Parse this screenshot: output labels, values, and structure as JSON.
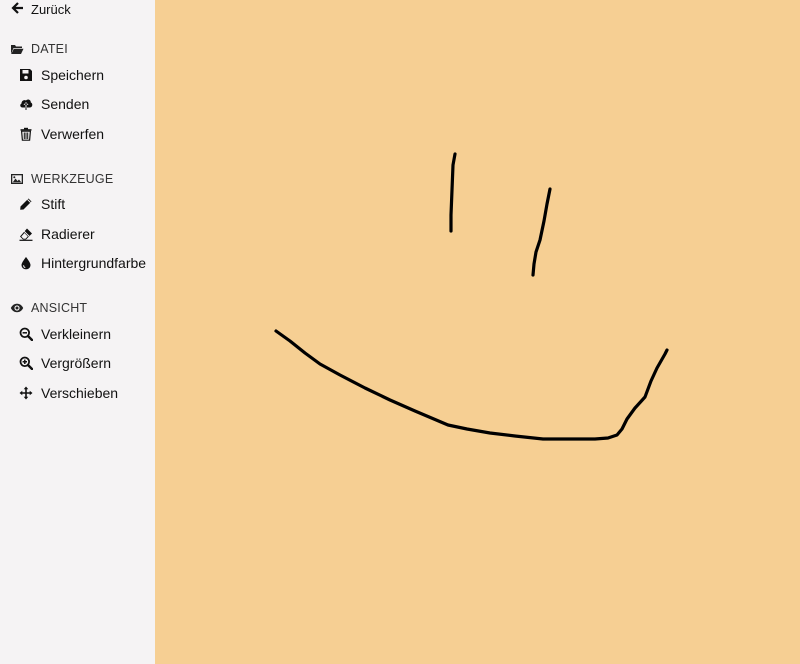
{
  "nav": {
    "back_label": "Zurück"
  },
  "sections": {
    "datei": {
      "title": "DATEI",
      "items": {
        "save": "Speichern",
        "send": "Senden",
        "discard": "Verwerfen"
      }
    },
    "werkzeuge": {
      "title": "WERKZEUGE",
      "items": {
        "pen": "Stift",
        "eraser": "Radierer",
        "background": "Hintergrundfarbe"
      }
    },
    "ansicht": {
      "title": "ANSICHT",
      "items": {
        "zoom_out": "Verkleinern",
        "zoom_in": "Vergrößern",
        "pan": "Verschieben"
      }
    }
  },
  "canvas": {
    "background_color": "#f6cf93",
    "stroke_color": "#000000"
  },
  "colors": {
    "sidebar_bg": "#f5f3f4",
    "text": "#111111"
  }
}
